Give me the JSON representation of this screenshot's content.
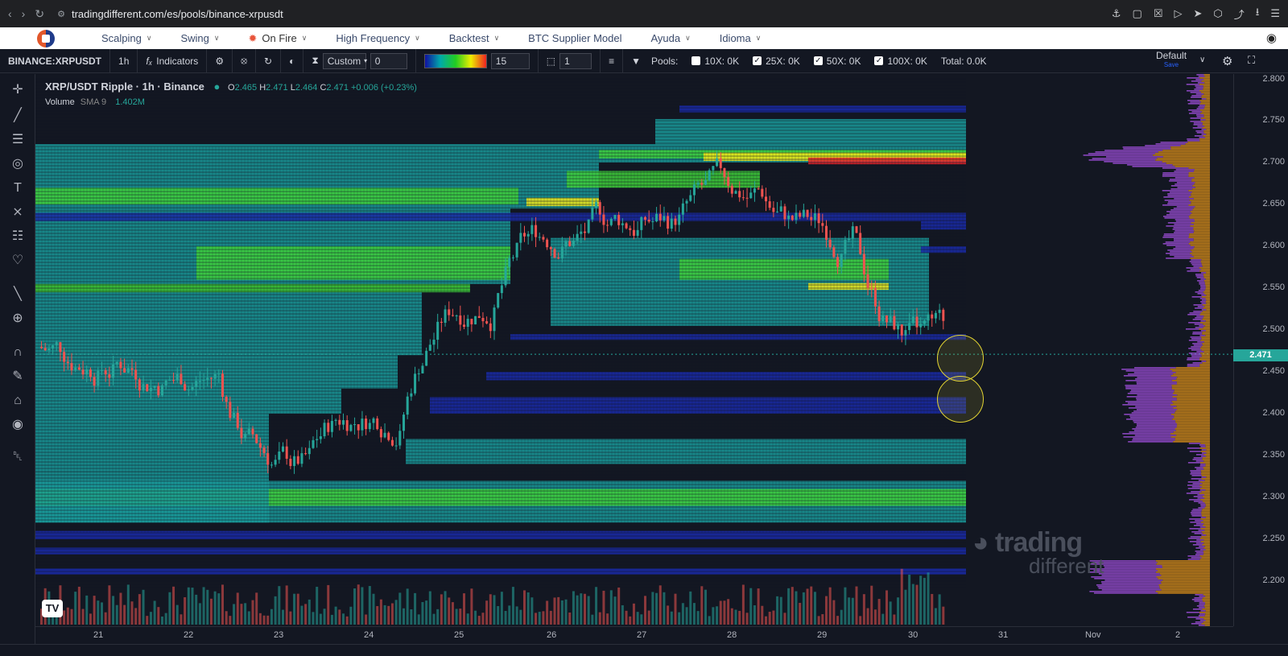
{
  "browser": {
    "url": "tradingdifferent.com/es/pools/binance-xrpusdt"
  },
  "site_menu": {
    "items": [
      {
        "label": "Scalping",
        "has_dropdown": true
      },
      {
        "label": "Swing",
        "has_dropdown": true
      },
      {
        "label": "On Fire",
        "has_dropdown": true,
        "icon": "fire-icon"
      },
      {
        "label": "High Frequency",
        "has_dropdown": true
      },
      {
        "label": "Backtest",
        "has_dropdown": true
      },
      {
        "label": "BTC Supplier Model",
        "has_dropdown": false
      },
      {
        "label": "Ayuda",
        "has_dropdown": true
      },
      {
        "label": "Idioma",
        "has_dropdown": true
      }
    ]
  },
  "toolbar": {
    "symbol": "BINANCE:XRPUSDT",
    "interval": "1h",
    "indicators_label": "Indicators",
    "mode_select": "Custom",
    "mode_value": "0",
    "gradient_value": "15",
    "layers_value": "1",
    "pools_label": "Pools:",
    "pools": [
      {
        "label": "10X: 0K",
        "checked": false
      },
      {
        "label": "25X: 0K",
        "checked": true
      },
      {
        "label": "50X: 0K",
        "checked": true
      },
      {
        "label": "100X: 0K",
        "checked": true
      }
    ],
    "total_label": "Total: 0.0K",
    "layout_name": "Default",
    "layout_sub": "Save"
  },
  "legend": {
    "title": "XRP/USDT Ripple · 1h · Binance",
    "o_label": "O",
    "o_value": "2.465",
    "h_label": "H",
    "h_value": "2.471",
    "l_label": "L",
    "l_value": "2.464",
    "c_label": "C",
    "c_value": "2.471",
    "change": "+0.006 (+0.23%)",
    "volume_label": "Volume",
    "sma_label": "SMA 9",
    "volume_value": "1.402M"
  },
  "price_axis": {
    "labels": [
      "2.800",
      "2.750",
      "2.700",
      "2.650",
      "2.600",
      "2.550",
      "2.500",
      "2.450",
      "2.400",
      "2.350",
      "2.300",
      "2.250",
      "2.200"
    ],
    "current_price": "2.471"
  },
  "time_axis": {
    "labels": [
      "21",
      "22",
      "23",
      "24",
      "25",
      "26",
      "27",
      "28",
      "29",
      "30",
      "31",
      "Nov",
      "2"
    ]
  },
  "watermark": {
    "line1": "trading",
    "line2": "different"
  },
  "colors": {
    "background": "#131722",
    "up": "#26a69a",
    "down": "#ef5350",
    "heat_low": "#1a2aa8",
    "heat_mid": "#1a9a9a",
    "heat_high": "#3fd13a",
    "heat_peak": "#f2e81a",
    "heat_max": "#e8242a",
    "circle": "#e3d432"
  },
  "chart_data": {
    "type": "candlestick",
    "title": "XRP/USDT Ripple · 1h · Binance",
    "x_categories": [
      "21",
      "22",
      "23",
      "24",
      "25",
      "26",
      "27",
      "28",
      "29",
      "30"
    ],
    "approx_daily_close": [
      2.47,
      2.45,
      2.33,
      2.41,
      2.55,
      2.62,
      2.63,
      2.66,
      2.61,
      2.47
    ],
    "ylim": [
      2.17,
      2.8
    ],
    "current": 2.471
  }
}
